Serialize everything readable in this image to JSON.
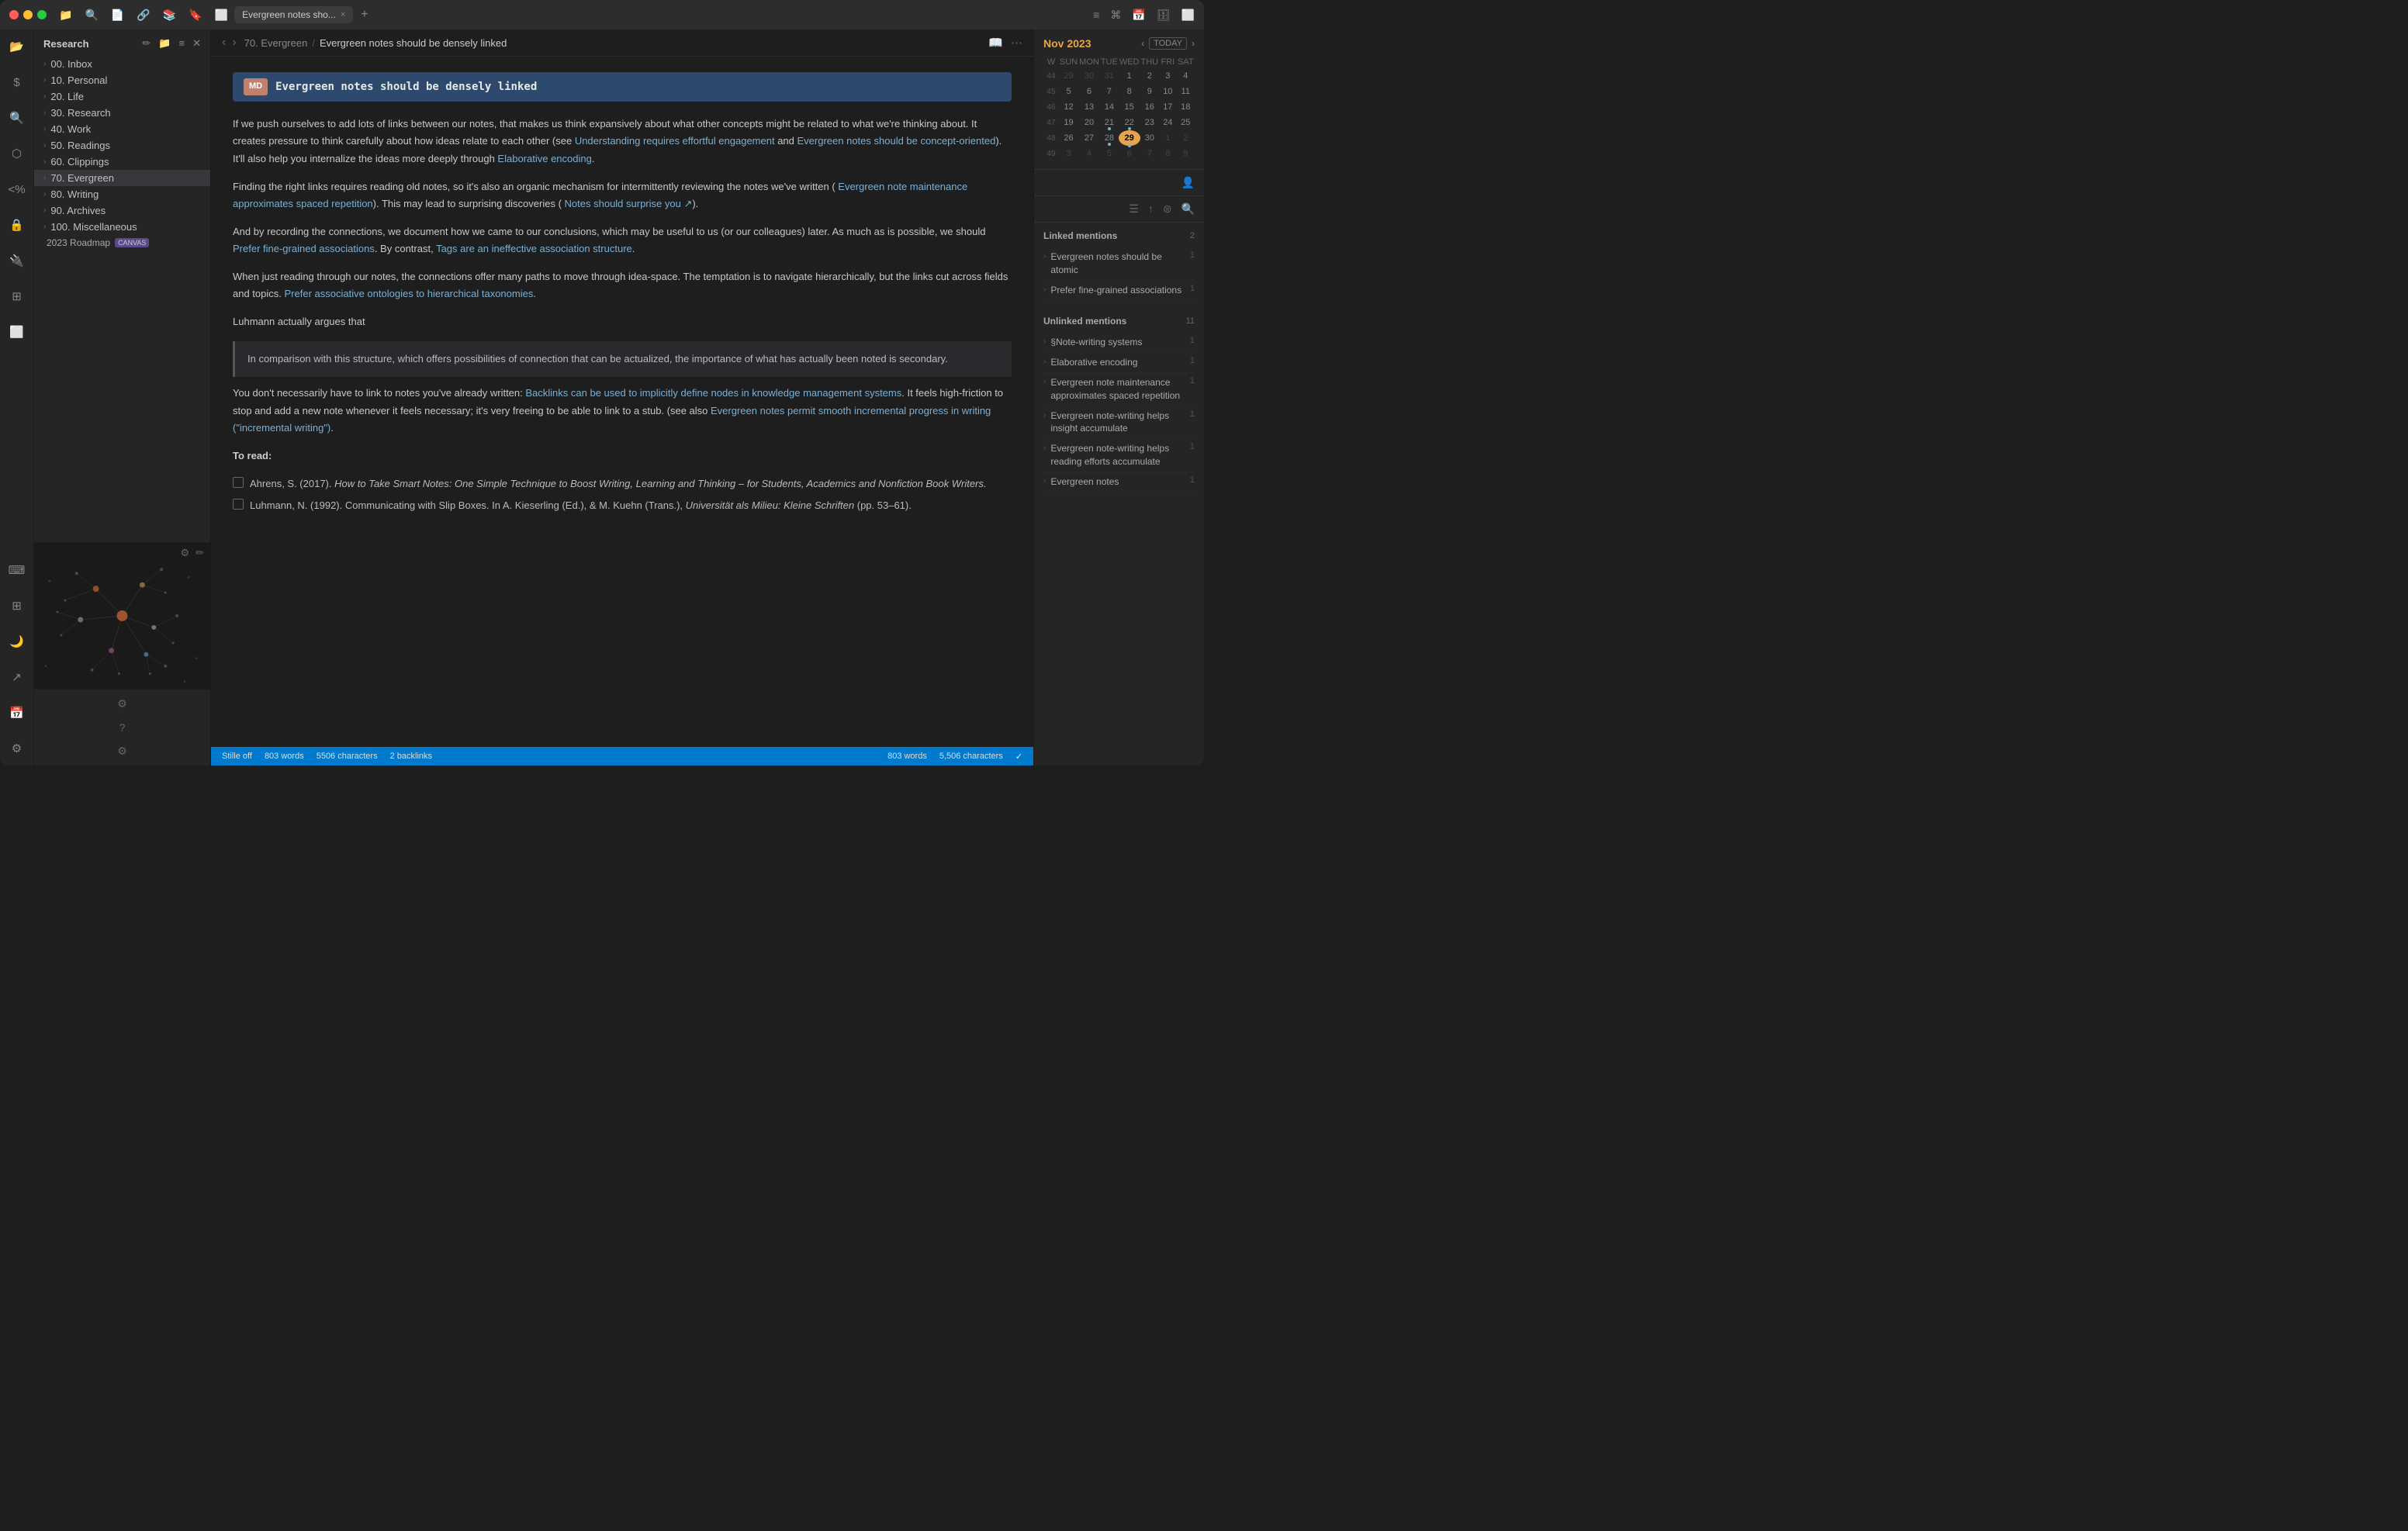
{
  "window": {
    "title": "Evergreen notes should be densely linked"
  },
  "titlebar": {
    "tab_label": "Evergreen notes sho...",
    "tab_close": "×",
    "tab_plus": "+",
    "dropdown_icon": "▾"
  },
  "titlebar_right_icons": [
    "≡",
    "⌘",
    "📅",
    "🗄️",
    "⬜"
  ],
  "sidebar": {
    "title": "Research",
    "header_icons": [
      "✏️",
      "📁",
      "≡",
      "×"
    ],
    "items": [
      {
        "label": "00. Inbox",
        "arrow": "›"
      },
      {
        "label": "10. Personal",
        "arrow": "›"
      },
      {
        "label": "20. Life",
        "arrow": "›"
      },
      {
        "label": "30. Research",
        "arrow": "›"
      },
      {
        "label": "40. Work",
        "arrow": "›"
      },
      {
        "label": "50. Readings",
        "arrow": "›"
      },
      {
        "label": "60. Clippings",
        "arrow": "›"
      },
      {
        "label": "70. Evergreen",
        "arrow": "›"
      },
      {
        "label": "80. Writing",
        "arrow": "›"
      },
      {
        "label": "90. Archives",
        "arrow": "›"
      },
      {
        "label": "100. Miscellaneous",
        "arrow": "›"
      }
    ],
    "special_item": {
      "label": "2023 Roadmap",
      "badge": "CANVAS"
    }
  },
  "editor": {
    "breadcrumb_parent": "70. Evergreen",
    "breadcrumb_sep": "/",
    "breadcrumb_current": "Evergreen notes should be densely linked",
    "note_badge": "MD",
    "note_title": "Evergreen notes should be densely linked",
    "paragraphs": [
      "If we push ourselves to add lots of links between our notes, that makes us think expansively about what other concepts might be related to what we're thinking about. It creates pressure to think carefully about how ideas relate to each other (see Understanding requires effortful engagement and Evergreen notes should be concept-oriented). It'll also help you internalize the ideas more deeply through Elaborative encoding.",
      "Finding the right links requires reading old notes, so it's also an organic mechanism for intermittently reviewing the notes we've written (Evergreen note maintenance approximates spaced repetition). This may lead to surprising discoveries (Notes should surprise you).",
      "And by recording the connections, we document how we came to our conclusions, which may be useful to us (or our colleagues) later. As much as is possible, we should Prefer fine-grained associations. By contrast, Tags are an ineffective association structure.",
      "When just reading through our notes, the connections offer many paths to move through idea-space. The temptation is to navigate hierarchically, but the links cut across fields and topics. Prefer associative ontologies to hierarchical taxonomies.",
      "Luhmann actually argues that"
    ],
    "blockquote": "In comparison with this structure, which offers possibilities of connection that can be actualized, the importance of what has actually been noted is secondary.",
    "para2": "You don't necessarily have to link to notes you've already written: Backlinks can be used to implicitly define nodes in knowledge management systems. It feels high-friction to stop and add a new note whenever it feels necessary; it's very freeing to be able to link to a stub. (see also Evergreen notes permit smooth incremental progress in writing (\"incremental writing\").",
    "to_read_heading": "To read:",
    "checklist": [
      "Ahrens, S. (2017). How to Take Smart Notes: One Simple Technique to Boost Writing, Learning and Thinking – for Students, Academics and Nonfiction Book Writers.",
      "Luhmann, N. (1992). Communicating with Slip Boxes. In A. Kieserling (Ed.), & M. Kuehn (Trans.), Universität als Milieu: Kleine Schriften (pp. 53–61)."
    ]
  },
  "status_bar": {
    "mode": "Stille off",
    "word_count": "803 words",
    "char_count": "5506 characters",
    "backlinks": "2 backlinks",
    "word_count2": "803 words",
    "char_count2": "5,506 characters"
  },
  "calendar": {
    "month": "Nov",
    "year": "2023",
    "today_btn": "TODAY",
    "days_header": [
      "W",
      "SUN",
      "MON",
      "TUE",
      "WED",
      "THU",
      "FRI",
      "SAT"
    ],
    "weeks": [
      {
        "num": "44",
        "days": [
          "29",
          "30",
          "31",
          "1",
          "2",
          "3",
          "4"
        ],
        "classes": [
          "prev",
          "prev",
          "prev",
          "",
          "",
          "",
          ""
        ]
      },
      {
        "num": "45",
        "days": [
          "5",
          "6",
          "7",
          "8",
          "9",
          "10",
          "11"
        ],
        "classes": [
          "",
          "",
          "",
          "",
          "",
          "",
          ""
        ]
      },
      {
        "num": "46",
        "days": [
          "12",
          "13",
          "14",
          "15",
          "16",
          "17",
          "18"
        ],
        "classes": [
          "",
          "",
          "",
          "",
          "",
          "",
          ""
        ]
      },
      {
        "num": "47",
        "days": [
          "19",
          "20",
          "21",
          "22",
          "23",
          "24",
          "25"
        ],
        "classes": [
          "",
          "",
          "",
          "",
          "",
          "",
          ""
        ]
      },
      {
        "num": "48",
        "days": [
          "26",
          "27",
          "28",
          "29",
          "30",
          "1",
          "2"
        ],
        "classes": [
          "",
          "",
          "dot",
          "dot",
          "",
          "next",
          "next"
        ]
      },
      {
        "num": "49",
        "days": [
          "3",
          "4",
          "5",
          "6",
          "7",
          "8",
          "9"
        ],
        "classes": [
          "next",
          "next",
          "next",
          "next",
          "next",
          "next",
          "next"
        ]
      }
    ],
    "today_date": "29"
  },
  "right_panel": {
    "linked_mentions_title": "Linked mentions",
    "linked_count": "2",
    "linked_items": [
      {
        "text": "Evergreen notes should be atomic",
        "count": "1"
      },
      {
        "text": "Prefer fine-grained associations",
        "count": "1"
      }
    ],
    "unlinked_mentions_title": "Unlinked mentions",
    "unlinked_count": "11",
    "unlinked_items": [
      {
        "text": "§Note-writing systems",
        "count": "1"
      },
      {
        "text": "Elaborative encoding",
        "count": "1"
      },
      {
        "text": "Evergreen note maintenance approximates spaced repetition",
        "count": "1"
      },
      {
        "text": "Evergreen note-writing helps insight accumulate",
        "count": "1"
      },
      {
        "text": "Evergreen note-writing helps reading efforts accumulate",
        "count": "1"
      },
      {
        "text": "Evergreen notes",
        "count": "1"
      }
    ]
  }
}
